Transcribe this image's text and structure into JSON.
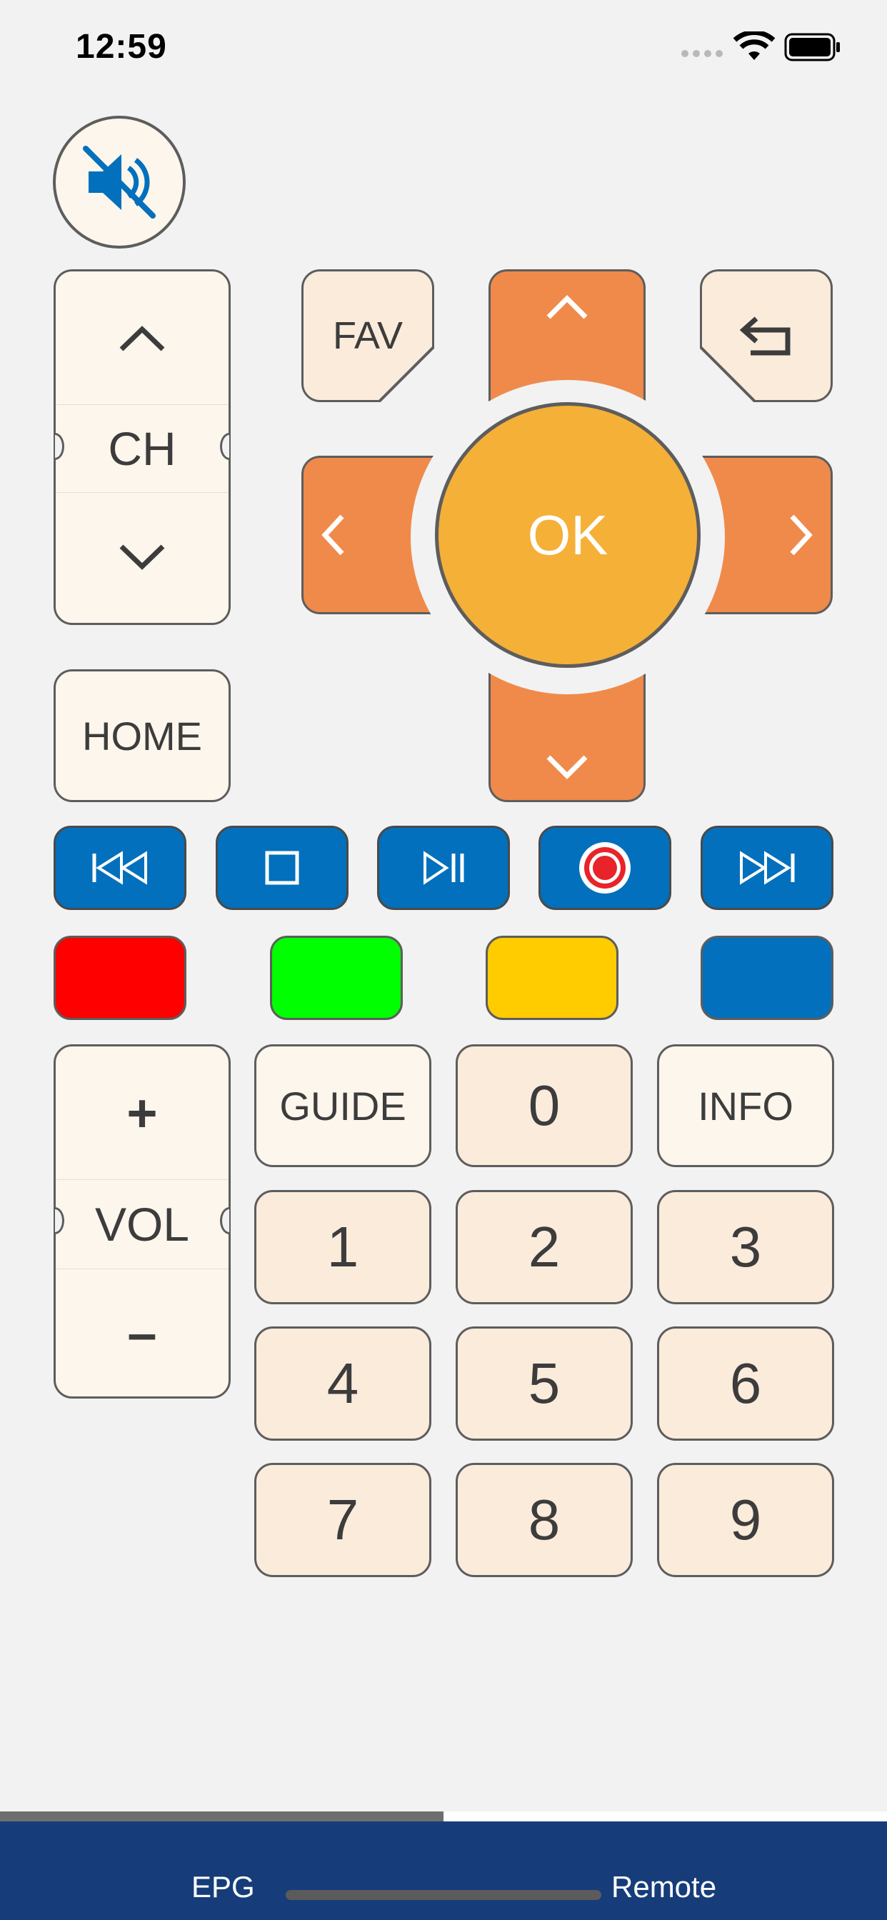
{
  "status_bar": {
    "time": "12:59"
  },
  "remote": {
    "mute_icon": "speaker-mute-icon",
    "channel": {
      "label": "CH",
      "up_icon": "chevron-up-icon",
      "down_icon": "chevron-down-icon"
    },
    "fav_label": "FAV",
    "back_icon": "return-arrow-icon",
    "ok_label": "OK",
    "home_label": "HOME",
    "media": [
      "previous-icon",
      "stop-icon",
      "play-pause-icon",
      "record-icon",
      "next-icon"
    ],
    "color_keys": [
      {
        "name": "red",
        "color": "#ff0000"
      },
      {
        "name": "green",
        "color": "#00ff00"
      },
      {
        "name": "yellow",
        "color": "#ffcc00"
      },
      {
        "name": "blue",
        "color": "#0270bd"
      }
    ],
    "volume": {
      "label": "VOL",
      "plus": "+",
      "minus": "–"
    },
    "guide_label": "GUIDE",
    "info_label": "INFO",
    "digits": [
      "0",
      "1",
      "2",
      "3",
      "4",
      "5",
      "6",
      "7",
      "8",
      "9"
    ]
  },
  "colors": {
    "accent_orange": "#ef8a4b",
    "ok_yellow": "#f5b038",
    "media_blue": "#0270bd",
    "tabbar": "#163d7a"
  },
  "progress": 0.5,
  "tabbar": {
    "tabs": [
      "EPG",
      "Remote"
    ]
  }
}
